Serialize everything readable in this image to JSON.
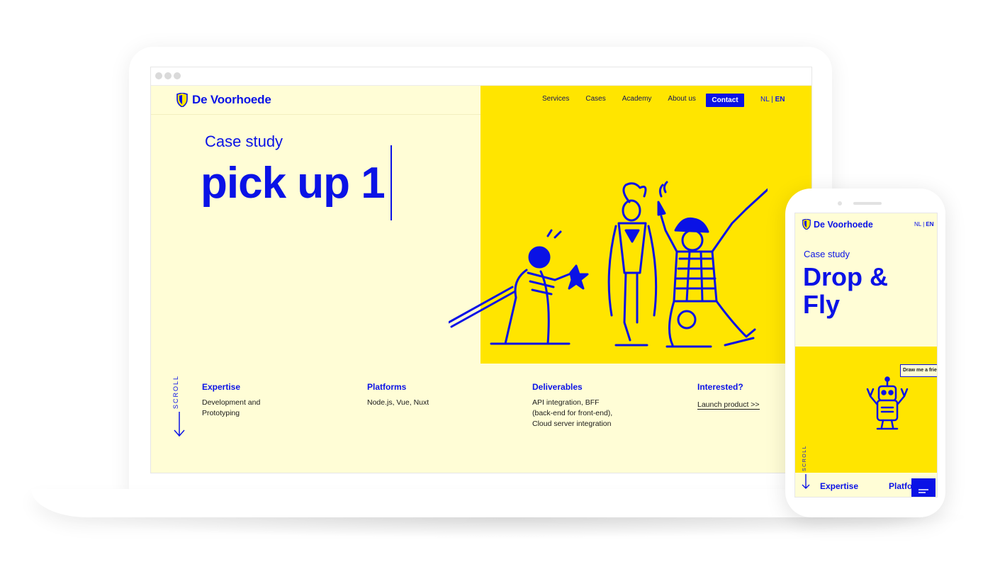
{
  "desktop": {
    "logo_text": "De Voorhoede",
    "nav": [
      "Services",
      "Cases",
      "Academy",
      "About us"
    ],
    "contact_label": "Contact",
    "lang_nl": "NL",
    "lang_sep": " | ",
    "lang_en": "EN",
    "eyebrow": "Case study",
    "headline": "pick up 1",
    "scroll_label": "SCROLL",
    "info": {
      "expertise_title": "Expertise",
      "expertise_text": "Development and Prototyping",
      "platforms_title": "Platforms",
      "platforms_text": "Node.js, Vue, Nuxt",
      "deliverables_title": "Deliverables",
      "deliverables_text": "API integration, BFF (back-end for front-end), Cloud server integration",
      "interested_title": "Interested?",
      "launch_label": "Launch product >>"
    }
  },
  "mobile": {
    "logo_text": "De Voorhoede",
    "lang_nl": "NL",
    "lang_sep": " | ",
    "lang_en": "EN",
    "eyebrow": "Case study",
    "title": "Drop & Fly",
    "bubble": "Draw me a frien",
    "scroll_label": "SCROLL",
    "expertise": "Expertise",
    "platforms": "Platfo"
  },
  "colors": {
    "brand_blue": "#0a12e6",
    "brand_yellow": "#ffe500",
    "cream": "#fffdd6"
  }
}
